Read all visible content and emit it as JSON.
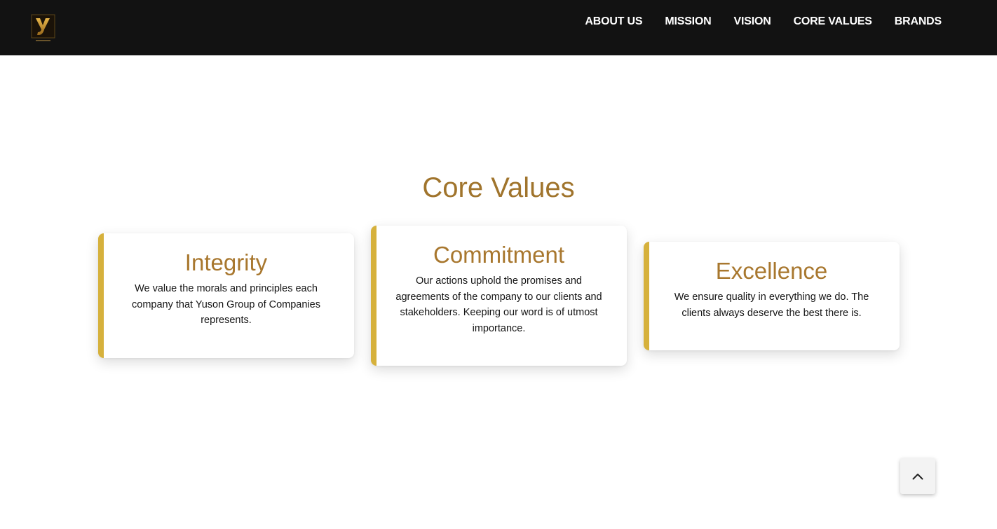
{
  "header": {
    "logo_icon": "yuson-logo",
    "nav": [
      {
        "label": "ABOUT US"
      },
      {
        "label": "MISSION"
      },
      {
        "label": "VISION"
      },
      {
        "label": "CORE VALUES"
      },
      {
        "label": "BRANDS"
      }
    ]
  },
  "section": {
    "title": "Core Values"
  },
  "cards": [
    {
      "title": "Integrity",
      "description": "We value the morals and principles each company that Yuson Group of Companies represents."
    },
    {
      "title": "Commitment",
      "description": "Our actions uphold the promises and agreements of the company to our clients and stakeholders. Keeping our word is of utmost importance."
    },
    {
      "title": "Excellence",
      "description": "We ensure quality in everything we do. The clients always deserve the best there is."
    }
  ],
  "scroll_top": {
    "icon": "chevron-up-icon"
  },
  "colors": {
    "navbar_bg": "#121212",
    "accent_gold": "#d6b13c",
    "title_brown": "#a0742c"
  }
}
